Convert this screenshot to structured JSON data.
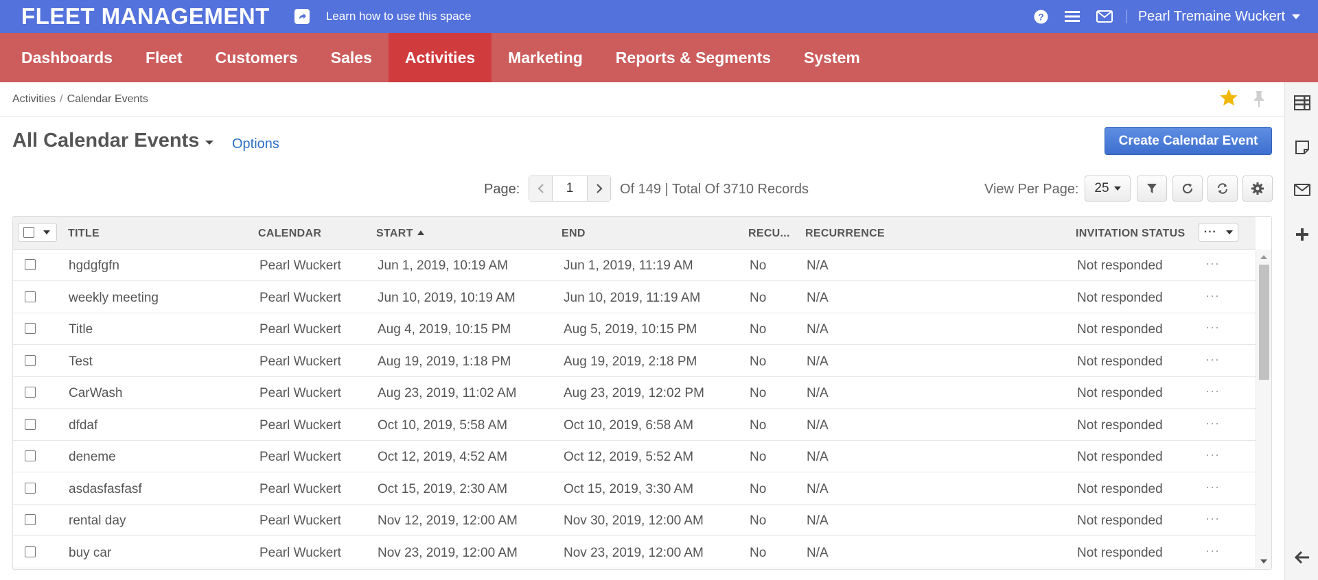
{
  "app": {
    "brand": "FLEET MANAGEMENT",
    "learn_link": "Learn how to use this space",
    "user_name": "Pearl Tremaine Wuckert"
  },
  "nav": {
    "items": [
      "Dashboards",
      "Fleet",
      "Customers",
      "Sales",
      "Activities",
      "Marketing",
      "Reports & Segments",
      "System"
    ],
    "active": "Activities"
  },
  "breadcrumb": {
    "parent": "Activities",
    "separator": "/",
    "current": "Calendar Events"
  },
  "page": {
    "title": "All Calendar Events",
    "options_label": "Options",
    "create_button": "Create Calendar Event"
  },
  "pagination": {
    "page_label": "Page:",
    "current_page": "1",
    "info": "Of 149 | Total Of 3710 Records",
    "per_page_label": "View Per Page:",
    "per_page": "25"
  },
  "grid": {
    "columns": {
      "title": "TITLE",
      "calendar": "CALENDAR",
      "start": "START",
      "end": "END",
      "recurrent": "RECU...",
      "recurrence": "RECURRENCE",
      "invitation": "INVITATION STATUS"
    },
    "sorted_column": "START",
    "sort_direction": "ascending",
    "rows": [
      {
        "title": "hgdgfgfn",
        "calendar": "Pearl Wuckert",
        "start": "Jun 1, 2019, 10:19 AM",
        "end": "Jun 1, 2019, 11:19 AM",
        "recurrent": "No",
        "recurrence": "N/A",
        "invitation": "Not responded"
      },
      {
        "title": "weekly meeting",
        "calendar": "Pearl Wuckert",
        "start": "Jun 10, 2019, 10:19 AM",
        "end": "Jun 10, 2019, 11:19 AM",
        "recurrent": "No",
        "recurrence": "N/A",
        "invitation": "Not responded"
      },
      {
        "title": "Title",
        "calendar": "Pearl Wuckert",
        "start": "Aug 4, 2019, 10:15 PM",
        "end": "Aug 5, 2019, 10:15 PM",
        "recurrent": "No",
        "recurrence": "N/A",
        "invitation": "Not responded"
      },
      {
        "title": "Test",
        "calendar": "Pearl Wuckert",
        "start": "Aug 19, 2019, 1:18 PM",
        "end": "Aug 19, 2019, 2:18 PM",
        "recurrent": "No",
        "recurrence": "N/A",
        "invitation": "Not responded"
      },
      {
        "title": "CarWash",
        "calendar": "Pearl Wuckert",
        "start": "Aug 23, 2019, 11:02 AM",
        "end": "Aug 23, 2019, 12:02 PM",
        "recurrent": "No",
        "recurrence": "N/A",
        "invitation": "Not responded"
      },
      {
        "title": "dfdaf",
        "calendar": "Pearl Wuckert",
        "start": "Oct 10, 2019, 5:58 AM",
        "end": "Oct 10, 2019, 6:58 AM",
        "recurrent": "No",
        "recurrence": "N/A",
        "invitation": "Not responded"
      },
      {
        "title": "deneme",
        "calendar": "Pearl Wuckert",
        "start": "Oct 12, 2019, 4:52 AM",
        "end": "Oct 12, 2019, 5:52 AM",
        "recurrent": "No",
        "recurrence": "N/A",
        "invitation": "Not responded"
      },
      {
        "title": "asdasfasfasf",
        "calendar": "Pearl Wuckert",
        "start": "Oct 15, 2019, 2:30 AM",
        "end": "Oct 15, 2019, 3:30 AM",
        "recurrent": "No",
        "recurrence": "N/A",
        "invitation": "Not responded"
      },
      {
        "title": "rental day",
        "calendar": "Pearl Wuckert",
        "start": "Nov 12, 2019, 12:00 AM",
        "end": "Nov 30, 2019, 12:00 AM",
        "recurrent": "No",
        "recurrence": "N/A",
        "invitation": "Not responded"
      },
      {
        "title": "buy car",
        "calendar": "Pearl Wuckert",
        "start": "Nov 23, 2019, 12:00 AM",
        "end": "Nov 23, 2019, 12:00 AM",
        "recurrent": "No",
        "recurrence": "N/A",
        "invitation": "Not responded"
      }
    ]
  },
  "icons": {
    "top": [
      "share-icon",
      "help-icon",
      "menu-icon",
      "mail-icon"
    ],
    "rail": [
      "sidebar-list-icon",
      "note-icon",
      "mail-icon",
      "plus-icon",
      "back-arrow-icon"
    ],
    "toolbar": [
      "filter-icon",
      "reset-icon",
      "refresh-icon",
      "settings-icon"
    ]
  },
  "colors": {
    "topbar": "#5372dc",
    "nav": "#cd5d5d",
    "nav_active": "#d03b3e",
    "primary_button": "#4a7bd6",
    "link": "#2c6fc5",
    "star": "#f2b705"
  }
}
